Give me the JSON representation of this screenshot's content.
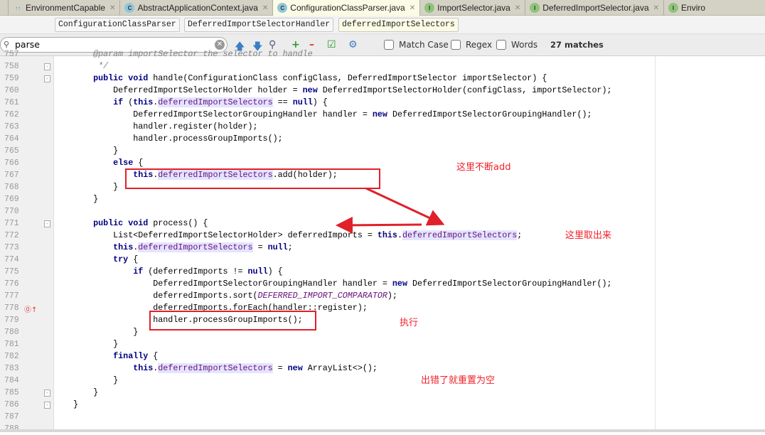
{
  "tabs": [
    {
      "label": "EnvironmentCapable",
      "icon": "interface-hierarchy-icon",
      "active": false
    },
    {
      "label": "AbstractApplicationContext.java",
      "icon": "class-icon",
      "active": false
    },
    {
      "label": "ConfigurationClassParser.java",
      "icon": "class-icon",
      "active": true
    },
    {
      "label": "ImportSelector.java",
      "icon": "interface-icon",
      "active": false
    },
    {
      "label": "DeferredImportSelector.java",
      "icon": "interface-icon",
      "active": false
    },
    {
      "label": "Enviro",
      "icon": "interface-icon",
      "active": false
    }
  ],
  "breadcrumbs": [
    "ConfigurationClassParser",
    "DeferredImportSelectorHandler",
    "deferredImportSelectors"
  ],
  "search": {
    "value": "parse",
    "match_case": "Match Case",
    "regex": "Regex",
    "words": "Words",
    "matches": "27 matches"
  },
  "lines": [
    {
      "n": "757",
      "t": [
        [
          "       ",
          "p"
        ],
        [
          "@param importSelector the selector to handle",
          "c"
        ]
      ]
    },
    {
      "n": "758",
      "t": [
        [
          "        */",
          "c"
        ]
      ]
    },
    {
      "n": "759",
      "t": [
        [
          "       ",
          "p"
        ],
        [
          "public void ",
          "k"
        ],
        [
          "handle(ConfigurationClass configClass, DeferredImportSelector importSelector) {",
          "p"
        ]
      ]
    },
    {
      "n": "760",
      "t": [
        [
          "           DeferredImportSelectorHolder holder = ",
          "p"
        ],
        [
          "new ",
          "k"
        ],
        [
          "DeferredImportSelectorHolder(configClass, importSelector);",
          "p"
        ]
      ]
    },
    {
      "n": "761",
      "t": [
        [
          "           ",
          "p"
        ],
        [
          "if ",
          "k"
        ],
        [
          "(",
          "p"
        ],
        [
          "this",
          "k"
        ],
        [
          ".",
          "p"
        ],
        [
          "deferredImportSelectors",
          "f"
        ],
        [
          " == ",
          "p"
        ],
        [
          "null",
          "k"
        ],
        [
          ") {",
          "p"
        ]
      ]
    },
    {
      "n": "762",
      "t": [
        [
          "               DeferredImportSelectorGroupingHandler handler = ",
          "p"
        ],
        [
          "new ",
          "k"
        ],
        [
          "DeferredImportSelectorGroupingHandler();",
          "p"
        ]
      ]
    },
    {
      "n": "763",
      "t": [
        [
          "               handler.register(holder);",
          "p"
        ]
      ]
    },
    {
      "n": "764",
      "t": [
        [
          "               handler.processGroupImports();",
          "p"
        ]
      ]
    },
    {
      "n": "765",
      "t": [
        [
          "           }",
          "p"
        ]
      ]
    },
    {
      "n": "766",
      "t": [
        [
          "           ",
          "p"
        ],
        [
          "else ",
          "k"
        ],
        [
          "{",
          "p"
        ]
      ]
    },
    {
      "n": "767",
      "t": [
        [
          "               ",
          "p"
        ],
        [
          "this",
          "k"
        ],
        [
          ".",
          "p"
        ],
        [
          "deferredImportSelectors",
          "f"
        ],
        [
          ".add(holder);",
          "p"
        ]
      ]
    },
    {
      "n": "768",
      "t": [
        [
          "           }",
          "p"
        ]
      ]
    },
    {
      "n": "769",
      "t": [
        [
          "       }",
          "p"
        ]
      ]
    },
    {
      "n": "770",
      "t": []
    },
    {
      "n": "771",
      "t": [
        [
          "       ",
          "p"
        ],
        [
          "public void ",
          "k"
        ],
        [
          "process() {",
          "p"
        ]
      ]
    },
    {
      "n": "772",
      "t": [
        [
          "           List<DeferredImportSelectorHolder> deferredImports = ",
          "p"
        ],
        [
          "this",
          "k"
        ],
        [
          ".",
          "p"
        ],
        [
          "deferredImportSelectors",
          "f"
        ],
        [
          ";",
          "p"
        ]
      ]
    },
    {
      "n": "773",
      "t": [
        [
          "           ",
          "p"
        ],
        [
          "this",
          "k"
        ],
        [
          ".",
          "p"
        ],
        [
          "deferredImportSelectors",
          "f"
        ],
        [
          " = ",
          "p"
        ],
        [
          "null",
          "k"
        ],
        [
          ";",
          "p"
        ]
      ]
    },
    {
      "n": "774",
      "t": [
        [
          "           ",
          "p"
        ],
        [
          "try ",
          "k"
        ],
        [
          "{",
          "p"
        ]
      ]
    },
    {
      "n": "775",
      "t": [
        [
          "               ",
          "p"
        ],
        [
          "if ",
          "k"
        ],
        [
          "(deferredImports != ",
          "p"
        ],
        [
          "null",
          "k"
        ],
        [
          ") {",
          "p"
        ]
      ]
    },
    {
      "n": "776",
      "t": [
        [
          "                   DeferredImportSelectorGroupingHandler handler = ",
          "p"
        ],
        [
          "new ",
          "k"
        ],
        [
          "DeferredImportSelectorGroupingHandler();",
          "p"
        ]
      ]
    },
    {
      "n": "777",
      "t": [
        [
          "                   deferredImports.sort(",
          "p"
        ],
        [
          "DEFERRED_IMPORT_COMPARATOR",
          "s"
        ],
        [
          ");",
          "p"
        ]
      ]
    },
    {
      "n": "778",
      "t": [
        [
          "                   deferredImports.forEach(handler::register);",
          "p"
        ]
      ]
    },
    {
      "n": "779",
      "t": [
        [
          "                   handler.processGroupImports();",
          "p"
        ]
      ]
    },
    {
      "n": "780",
      "t": [
        [
          "               }",
          "p"
        ]
      ]
    },
    {
      "n": "781",
      "t": [
        [
          "           }",
          "p"
        ]
      ]
    },
    {
      "n": "782",
      "t": [
        [
          "           ",
          "p"
        ],
        [
          "finally ",
          "k"
        ],
        [
          "{",
          "p"
        ]
      ]
    },
    {
      "n": "783",
      "t": [
        [
          "               ",
          "p"
        ],
        [
          "this",
          "k"
        ],
        [
          ".",
          "p"
        ],
        [
          "deferredImportSelectors",
          "f"
        ],
        [
          " = ",
          "p"
        ],
        [
          "new ",
          "k"
        ],
        [
          "ArrayList<>();",
          "p"
        ]
      ]
    },
    {
      "n": "784",
      "t": [
        [
          "           }",
          "p"
        ]
      ]
    },
    {
      "n": "785",
      "t": [
        [
          "       }",
          "p"
        ]
      ]
    },
    {
      "n": "786",
      "t": [
        [
          "   }",
          "p"
        ]
      ]
    },
    {
      "n": "787",
      "t": []
    },
    {
      "n": "788",
      "t": []
    }
  ],
  "annotations": {
    "add": "这里不断add",
    "take": "这里取出来",
    "exec": "执行",
    "reset": "出错了就重置为空"
  },
  "colors": {
    "annotation": "#e0202a",
    "keyword": "#000080",
    "field": "#660e7a",
    "field_highlight": "#e4e4ff"
  }
}
